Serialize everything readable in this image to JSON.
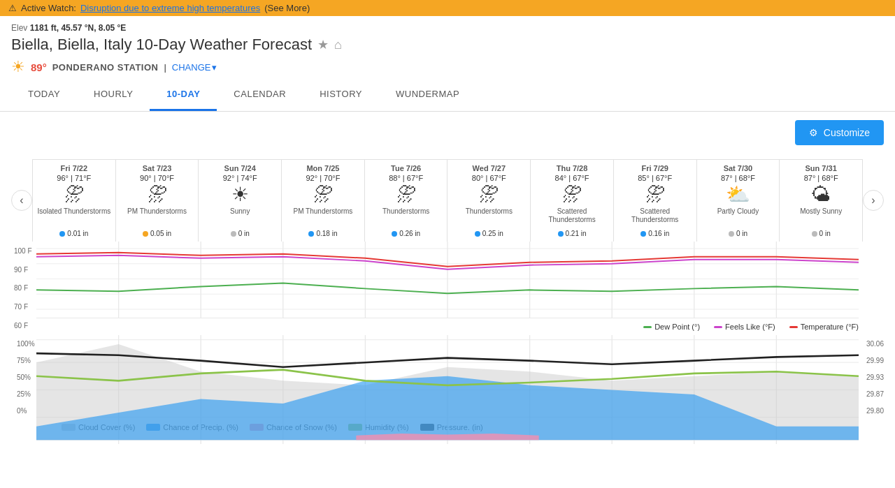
{
  "alert": {
    "icon": "⚠",
    "text": "Active Watch:",
    "link_text": "Disruption due to extreme high temperatures",
    "link_suffix": "(See More)"
  },
  "header": {
    "elev": "1181 ft, 45.57 °N, 8.05 °E",
    "title": "Biella, Biella, Italy 10-Day Weather Forecast",
    "temp": "89°",
    "station": "PONDERANO STATION",
    "change_label": "CHANGE"
  },
  "tabs": [
    {
      "id": "today",
      "label": "TODAY"
    },
    {
      "id": "hourly",
      "label": "HOURLY"
    },
    {
      "id": "10day",
      "label": "10-DAY",
      "active": true
    },
    {
      "id": "calendar",
      "label": "CALENDAR"
    },
    {
      "id": "history",
      "label": "HISTORY"
    },
    {
      "id": "wundermap",
      "label": "WUNDERMAP"
    }
  ],
  "customize_label": "Customize",
  "forecast": [
    {
      "date": "Fri 7/22",
      "temps": "96° | 71°F",
      "icon": "⛈",
      "condition": "Isolated Thunderstorms",
      "precip": "0.01 in",
      "precip_type": "blue"
    },
    {
      "date": "Sat 7/23",
      "temps": "90° | 70°F",
      "icon": "⛈",
      "condition": "PM Thunderstorms",
      "precip": "0.05 in",
      "precip_type": "yellow"
    },
    {
      "date": "Sun 7/24",
      "temps": "92° | 74°F",
      "icon": "☀",
      "condition": "Sunny",
      "precip": "0 in",
      "precip_type": "gray"
    },
    {
      "date": "Mon 7/25",
      "temps": "92° | 70°F",
      "icon": "⛈",
      "condition": "PM Thunderstorms",
      "precip": "0.18 in",
      "precip_type": "blue"
    },
    {
      "date": "Tue 7/26",
      "temps": "88° | 67°F",
      "icon": "⛈",
      "condition": "Thunderstorms",
      "precip": "0.26 in",
      "precip_type": "blue"
    },
    {
      "date": "Wed 7/27",
      "temps": "80° | 67°F",
      "icon": "⛈",
      "condition": "Thunderstorms",
      "precip": "0.25 in",
      "precip_type": "blue"
    },
    {
      "date": "Thu 7/28",
      "temps": "84° | 67°F",
      "icon": "⛈",
      "condition": "Scattered Thunderstorms",
      "precip": "0.21 in",
      "precip_type": "blue"
    },
    {
      "date": "Fri 7/29",
      "temps": "85° | 67°F",
      "icon": "⛈",
      "condition": "Scattered Thunderstorms",
      "precip": "0.16 in",
      "precip_type": "blue"
    },
    {
      "date": "Sat 7/30",
      "temps": "87° | 68°F",
      "icon": "⛅",
      "condition": "Partly Cloudy",
      "precip": "0 in",
      "precip_type": "gray"
    },
    {
      "date": "Sun 7/31",
      "temps": "87° | 68°F",
      "icon": "🌤",
      "condition": "Mostly Sunny",
      "precip": "0 in",
      "precip_type": "gray"
    }
  ],
  "chart": {
    "y_labels": [
      "100 F",
      "90 F",
      "80 F",
      "70 F",
      "60 F"
    ],
    "legend": [
      {
        "label": "Dew Point (°)",
        "color": "#4caf50"
      },
      {
        "label": "Feels Like (°F)",
        "color": "#cc44cc"
      },
      {
        "label": "Temperature (°F)",
        "color": "#e53935"
      }
    ]
  },
  "secondary_chart": {
    "y_labels_left": [
      "100%",
      "75%",
      "50%",
      "25%",
      "0%"
    ],
    "y_labels_right": [
      "30.06",
      "29.99",
      "29.93",
      "29.87",
      "29.80"
    ],
    "legend": [
      {
        "label": "Cloud Cover (%)",
        "color": "#bbb"
      },
      {
        "label": "Chance of Precip. (%)",
        "color": "#2196F3"
      },
      {
        "label": "Chance of Snow (%)",
        "color": "#f48fb1"
      },
      {
        "label": "Humidity (%)",
        "color": "#8bc34a"
      },
      {
        "label": "Pressure. (in)",
        "color": "#212121"
      }
    ]
  }
}
